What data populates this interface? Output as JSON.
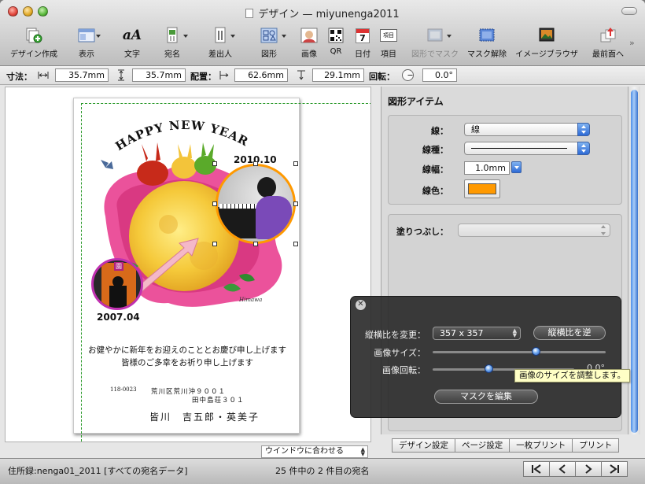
{
  "window": {
    "title": "デザイン — miyunenga2011"
  },
  "toolbar": {
    "items": [
      {
        "label": "デザイン作成"
      },
      {
        "label": "表示"
      },
      {
        "label": "文字"
      },
      {
        "label": "宛名"
      },
      {
        "label": "差出人"
      },
      {
        "label": "図形"
      },
      {
        "label": "画像"
      },
      {
        "label": "QR"
      },
      {
        "label": "日付"
      },
      {
        "label": "項目"
      },
      {
        "label": "図形でマスク"
      },
      {
        "label": "マスク解除"
      },
      {
        "label": "イメージブラウザ"
      },
      {
        "label": "最前面へ"
      }
    ],
    "calendar_day": "7",
    "text_icon": "aA",
    "item_icon": "項目"
  },
  "dimbar": {
    "size_label": "寸法：",
    "width": "35.7mm",
    "height": "35.7mm",
    "pos_label": "配置：",
    "x": "62.6mm",
    "y": "29.1mm",
    "rot_label": "回転：",
    "rotation": "0.0°"
  },
  "card": {
    "headline": "HAPPY NEW YEAR",
    "year_top": "2010.10",
    "year_bottom": "2007.04",
    "signature": "Himawa",
    "badge": "園",
    "greeting_1": "お健やかに新年をお迎えのこととお慶び申し上げます",
    "greeting_2": "皆様のご多幸をお祈り申し上げます",
    "postal": "118-0023",
    "address_1": "荒川区荒川沖９００１",
    "address_2": "田中島荘３０１",
    "sender": "皆川　吉五郎・英美子"
  },
  "canvas": {
    "fit_option": "ウインドウに合わせる"
  },
  "inspector": {
    "title": "図形アイテム",
    "line_label": "線：",
    "line_value": "線",
    "linetype_label": "線種：",
    "linewidth_label": "線幅：",
    "linewidth_value": "1.0mm",
    "linecolor_label": "線色：",
    "line_color": "#ff9900",
    "fill_label": "塗りつぶし：",
    "fill_value": ""
  },
  "hud": {
    "aspect_label": "縦横比を変更：",
    "aspect_value": "357 x 357",
    "swap_button": "縦横比を逆",
    "image_size_label": "画像サイズ：",
    "image_size_level": 0.6,
    "image_rotation_label": "画像回転：",
    "image_rotation_level": 0.4,
    "rotation_value": "0.0°",
    "edit_mask_button": "マスクを編集",
    "tooltip": "画像のサイズを調整します。"
  },
  "tabs": [
    {
      "label": "デザイン設定"
    },
    {
      "label": "ページ設定"
    },
    {
      "label": "一枚プリント"
    },
    {
      "label": "プリント"
    }
  ],
  "status": {
    "left": "住所録:nenga01_2011 [すべての宛名データ]",
    "center": "25 件中の 2 件目の宛名"
  }
}
